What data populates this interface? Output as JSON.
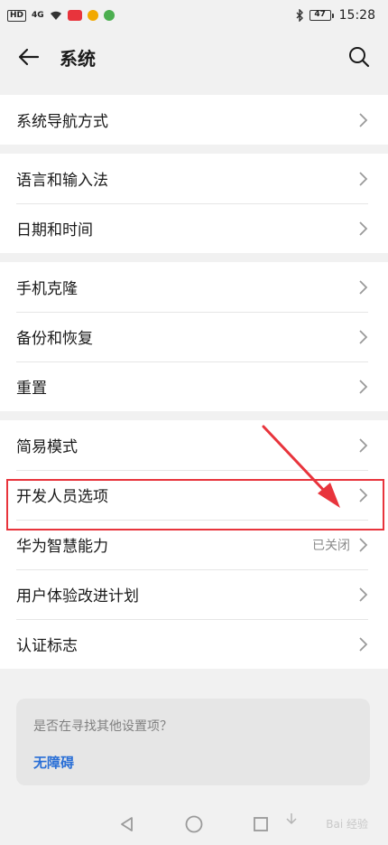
{
  "status_bar": {
    "hd_tag": "HD",
    "network": "4G",
    "time": "15:28",
    "battery": "47"
  },
  "app_bar": {
    "title": "系统"
  },
  "groups": [
    {
      "items": [
        {
          "label": "系统导航方式"
        }
      ]
    },
    {
      "items": [
        {
          "label": "语言和输入法"
        },
        {
          "label": "日期和时间"
        }
      ]
    },
    {
      "items": [
        {
          "label": "手机克隆"
        },
        {
          "label": "备份和恢复"
        },
        {
          "label": "重置"
        }
      ]
    },
    {
      "items": [
        {
          "label": "简易模式"
        },
        {
          "label": "开发人员选项"
        },
        {
          "label": "华为智慧能力",
          "value": "已关闭"
        },
        {
          "label": "用户体验改进计划"
        },
        {
          "label": "认证标志"
        }
      ]
    }
  ],
  "suggestion": {
    "question": "是否在寻找其他设置项？",
    "link": "无障碍"
  },
  "watermark": "Bai 经验",
  "colors": {
    "accent_link": "#2a6fd6",
    "highlight": "#e8343c"
  }
}
